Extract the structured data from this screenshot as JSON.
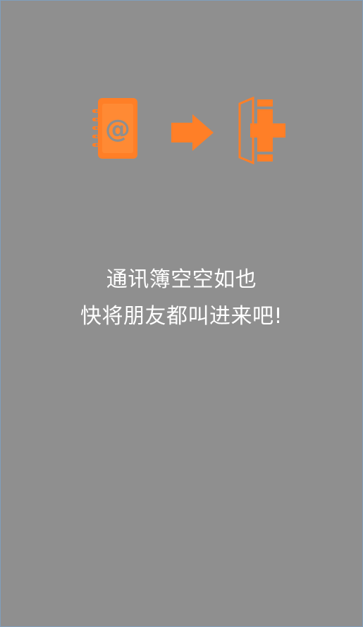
{
  "icons": {
    "address_book": "address-book-icon",
    "arrow": "arrow-right-icon",
    "destination": "door-plus-icon"
  },
  "colors": {
    "background": "#8f8f8f",
    "accent": "#ff7f27",
    "text": "#ffffff",
    "border": "#7f9fbd"
  },
  "empty_state": {
    "line1": "通讯簿空空如也",
    "line2": "快将朋友都叫进来吧!"
  }
}
